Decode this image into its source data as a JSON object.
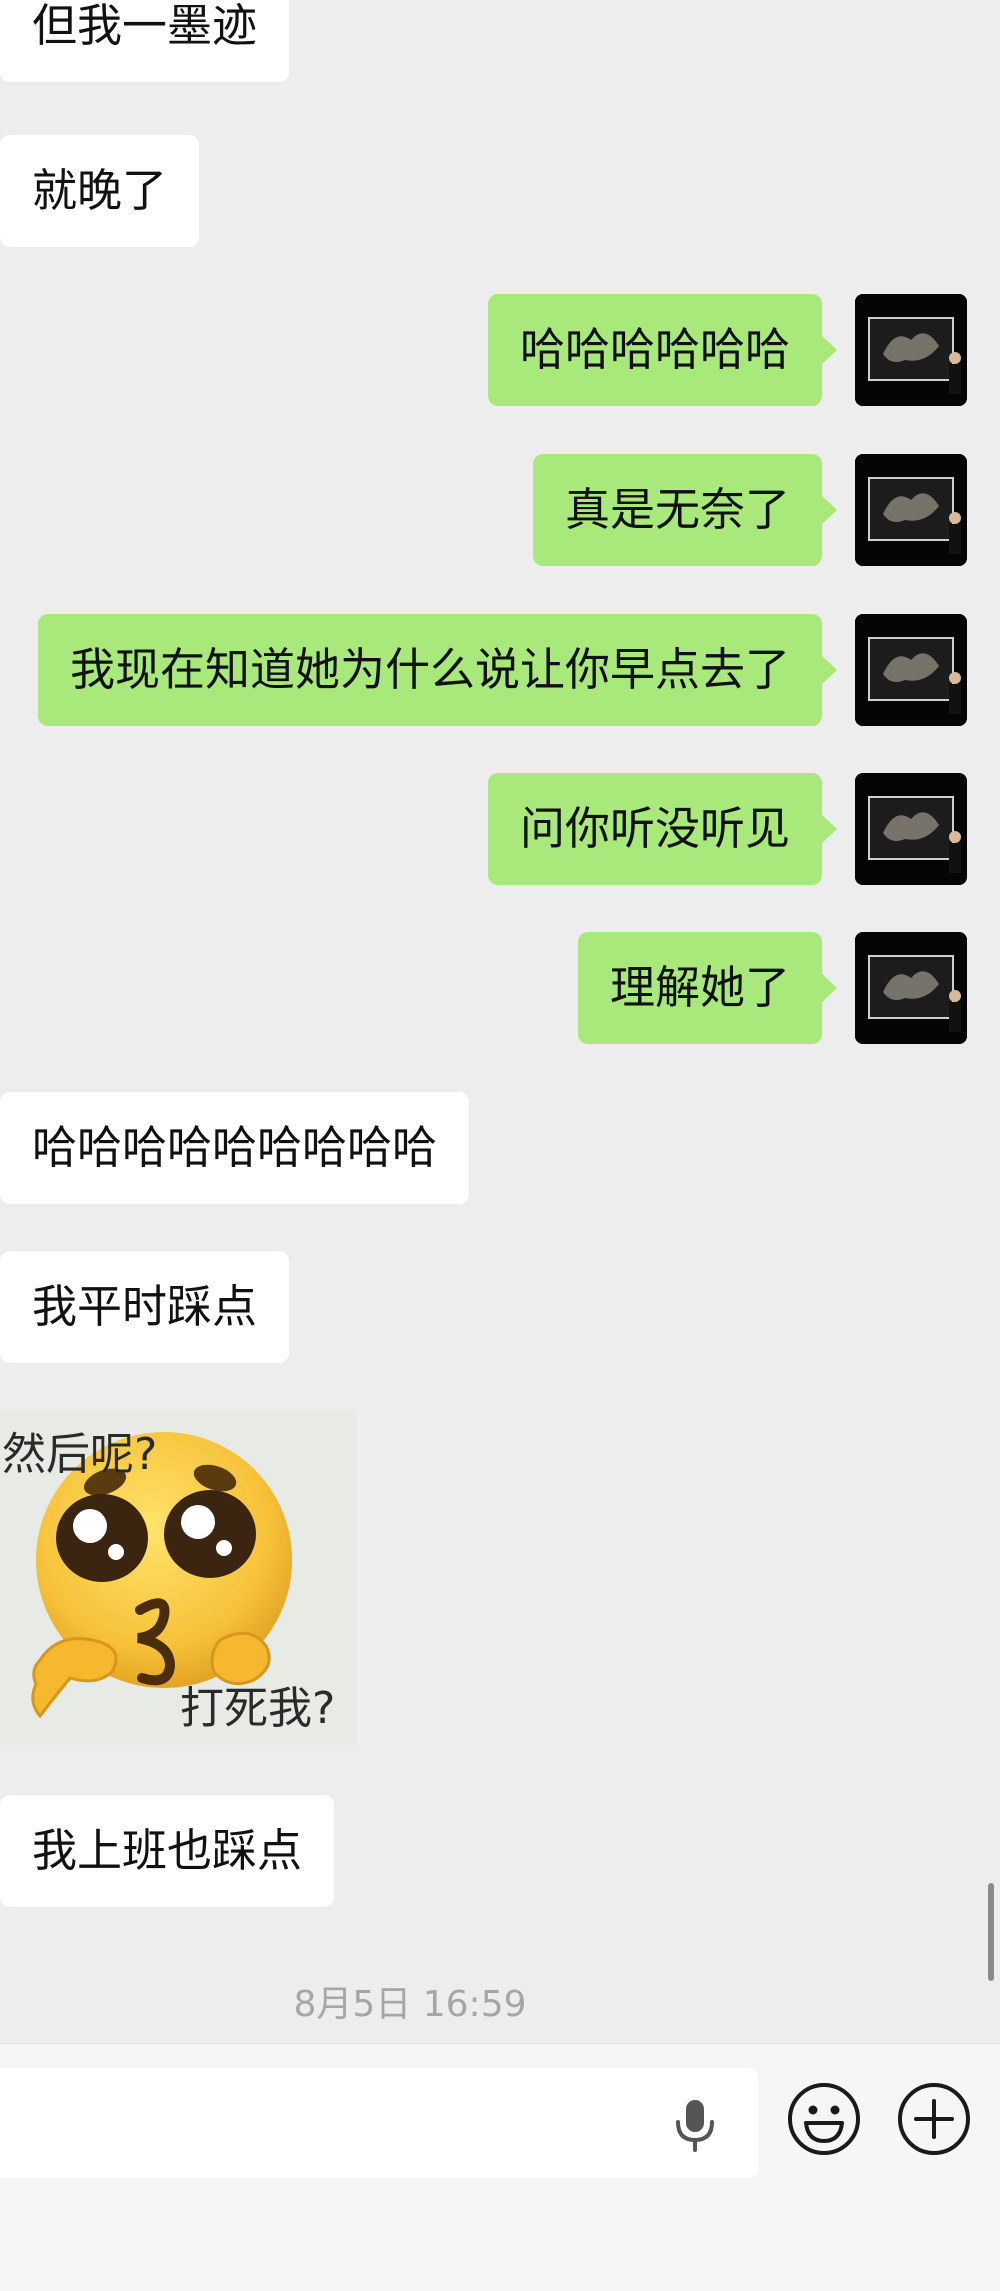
{
  "messages": [
    {
      "dir": "in",
      "text": "但我一墨迹"
    },
    {
      "dir": "in",
      "text": "就晚了"
    },
    {
      "dir": "out",
      "text": "哈哈哈哈哈哈"
    },
    {
      "dir": "out",
      "text": "真是无奈了"
    },
    {
      "dir": "out",
      "text": "我现在知道她为什么说让你早点去了"
    },
    {
      "dir": "out",
      "text": "问你听没听见"
    },
    {
      "dir": "out",
      "text": "理解她了"
    },
    {
      "dir": "in",
      "text": "哈哈哈哈哈哈哈哈哈"
    },
    {
      "dir": "in",
      "text": "我平时踩点"
    },
    {
      "dir": "in",
      "text": "我上班也踩点"
    }
  ],
  "sticker": {
    "caption_top": "然后呢?",
    "caption_bottom": "打死我?",
    "icon": "pleading-face-emoji"
  },
  "timestamp": "8月5日 16:59",
  "input_bar": {
    "voice_icon": "microphone-icon",
    "emoji_icon": "smiley-icon",
    "more_icon": "plus-circle-icon"
  },
  "colors": {
    "background": "#ededed",
    "incoming_bubble": "#ffffff",
    "outgoing_bubble": "#a9e97b"
  }
}
